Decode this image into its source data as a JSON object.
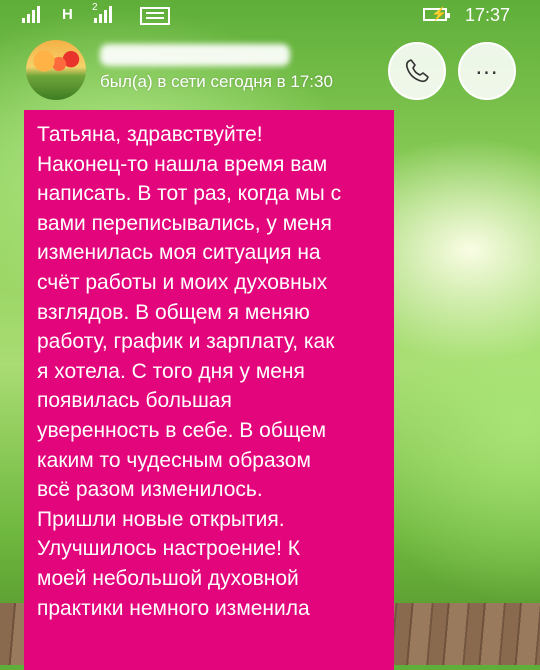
{
  "status_bar": {
    "network_label": "H",
    "sim_number": "2",
    "battery_glyph": "⚡",
    "time": "17:37",
    "icons": [
      "signal-icon",
      "message-icon",
      "battery-icon"
    ]
  },
  "header": {
    "contact_name": "",
    "last_seen": "был(а) в сети сегодня в 17:30",
    "buttons": [
      "call-icon",
      "more-icon"
    ]
  },
  "message": {
    "bubble_color": "#e3057c",
    "lines": [
      "Татьяна, здравствуйте!",
      "Наконец-то нашла время вам",
      "написать. В тот раз, когда мы с",
      "вами переписывались, у меня",
      "изменилась моя ситуация на",
      "счёт работы и моих духовных",
      "взглядов. В общем я меняю",
      "работу, график и зарплату, как",
      "я хотела. С того дня у меня",
      "появилась большая",
      "уверенность в себе. В общем",
      "каким то чудесным образом",
      "всё разом изменилось.",
      "Пришли новые открытия.",
      "Улучшилось настроение! К",
      "моей небольшой духовной",
      "практики немного изменила"
    ]
  }
}
